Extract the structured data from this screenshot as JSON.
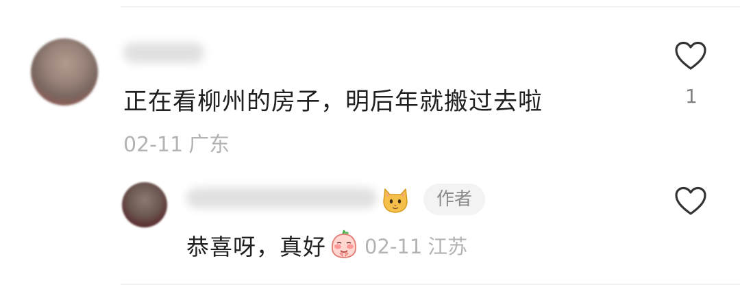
{
  "comment": {
    "text": "正在看柳州的房子，明后年就搬过去啦",
    "date": "02-11",
    "location": "广东",
    "like_count": "1",
    "icons": {
      "like": "heart-outline-icon"
    }
  },
  "reply": {
    "text": "恭喜呀，真好",
    "author_badge": "作者",
    "date": "02-11",
    "location": "江苏",
    "icons": {
      "name_emoji": "cat-face-icon",
      "sticker": "blushing-peach-sticker",
      "like": "heart-outline-icon"
    }
  },
  "colors": {
    "text_primary": "#1f1f1f",
    "text_meta": "#b3b3b3",
    "like_count": "#808080",
    "badge_bg": "#f3f3f3",
    "badge_text": "#8a8a8a",
    "icon_stroke": "#333333"
  }
}
